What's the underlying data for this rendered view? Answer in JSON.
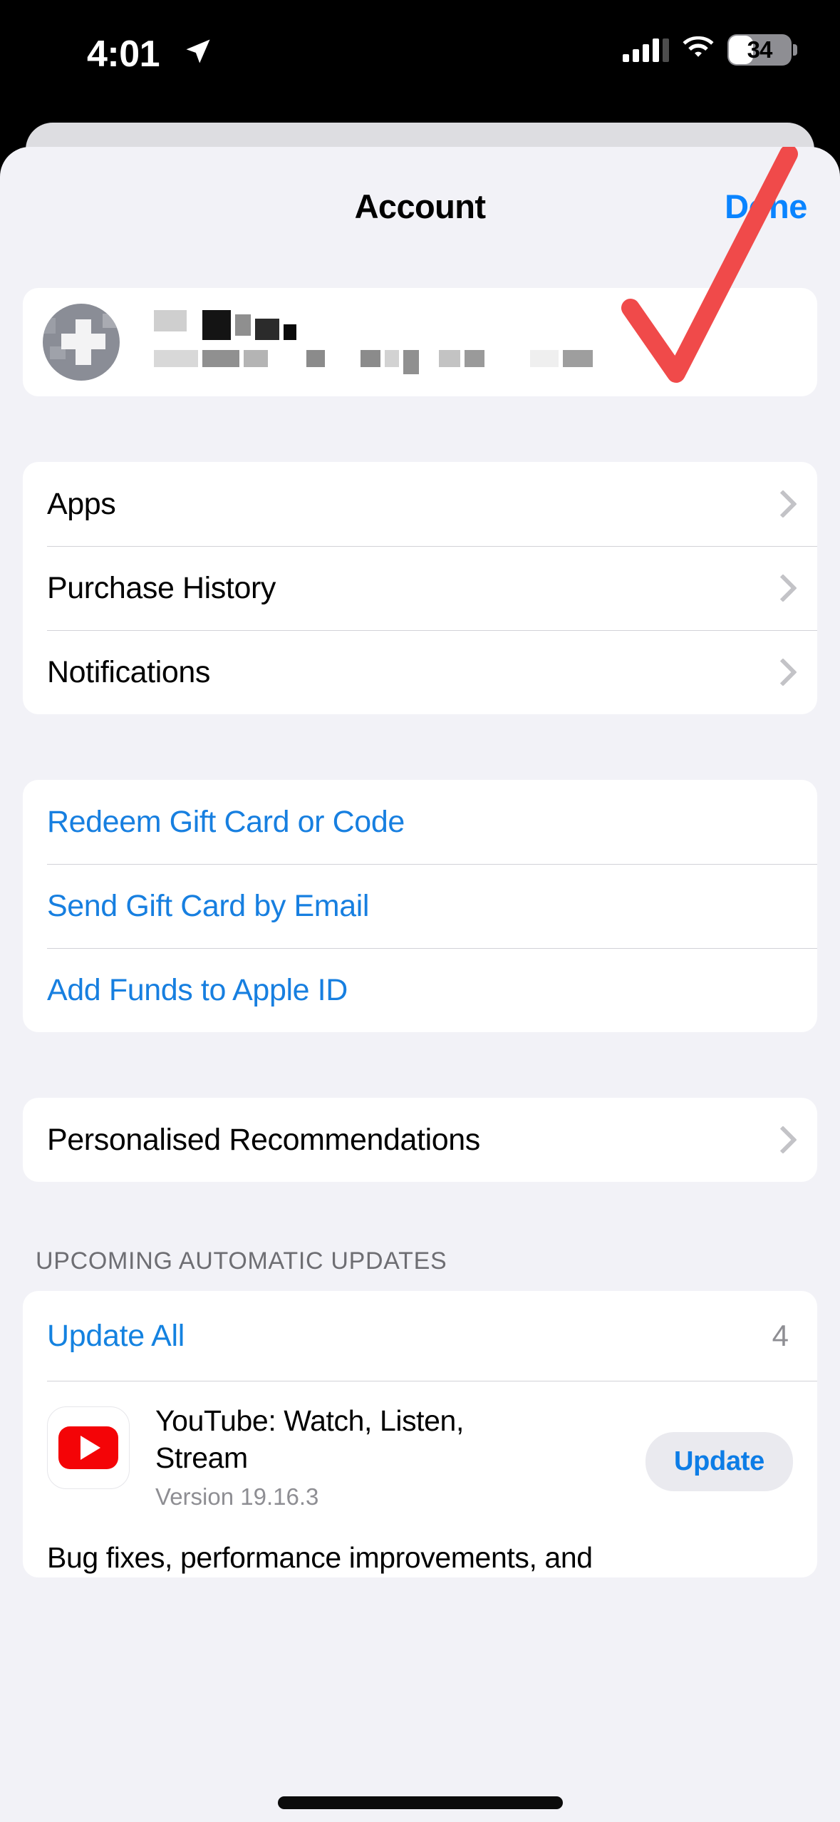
{
  "status_bar": {
    "time": "4:01",
    "location_icon": "location-arrow-icon",
    "cellular_icon": "cellular-signal-icon",
    "wifi_icon": "wifi-icon",
    "battery_level": "34",
    "battery_icon": "battery-icon"
  },
  "nav": {
    "title": "Account",
    "done_label": "Done"
  },
  "profile": {
    "avatar_icon": "redacted-avatar-icon",
    "name": "",
    "email": "",
    "redacted": true,
    "annotation": {
      "type": "check-mark",
      "color": "#F04A4A"
    }
  },
  "menu_section": {
    "items": [
      {
        "label": "Apps",
        "accessory": "chevron-right-icon"
      },
      {
        "label": "Purchase History",
        "accessory": "chevron-right-icon"
      },
      {
        "label": "Notifications",
        "accessory": "chevron-right-icon"
      }
    ]
  },
  "gift_section": {
    "items": [
      {
        "label": "Redeem Gift Card or Code"
      },
      {
        "label": "Send Gift Card by Email"
      },
      {
        "label": "Add Funds to Apple ID"
      }
    ]
  },
  "recommendations_section": {
    "items": [
      {
        "label": "Personalised Recommendations",
        "accessory": "chevron-right-icon"
      }
    ]
  },
  "updates_section": {
    "header": "UPCOMING AUTOMATIC UPDATES",
    "update_all_label": "Update All",
    "update_all_count": "4",
    "apps": [
      {
        "icon": "youtube-icon",
        "name": "YouTube: Watch, Listen, Stream",
        "version": "Version 19.16.3",
        "button_label": "Update",
        "description": "Bug fixes, performance improvements, and"
      }
    ]
  },
  "colors": {
    "accent_blue": "#1482E0",
    "done_blue": "#0A84FF",
    "background": "#F2F2F7",
    "card": "#FFFFFF",
    "annotation_red": "#F04A4A",
    "youtube_red": "#F40407",
    "secondary_text": "#8E8E93"
  }
}
